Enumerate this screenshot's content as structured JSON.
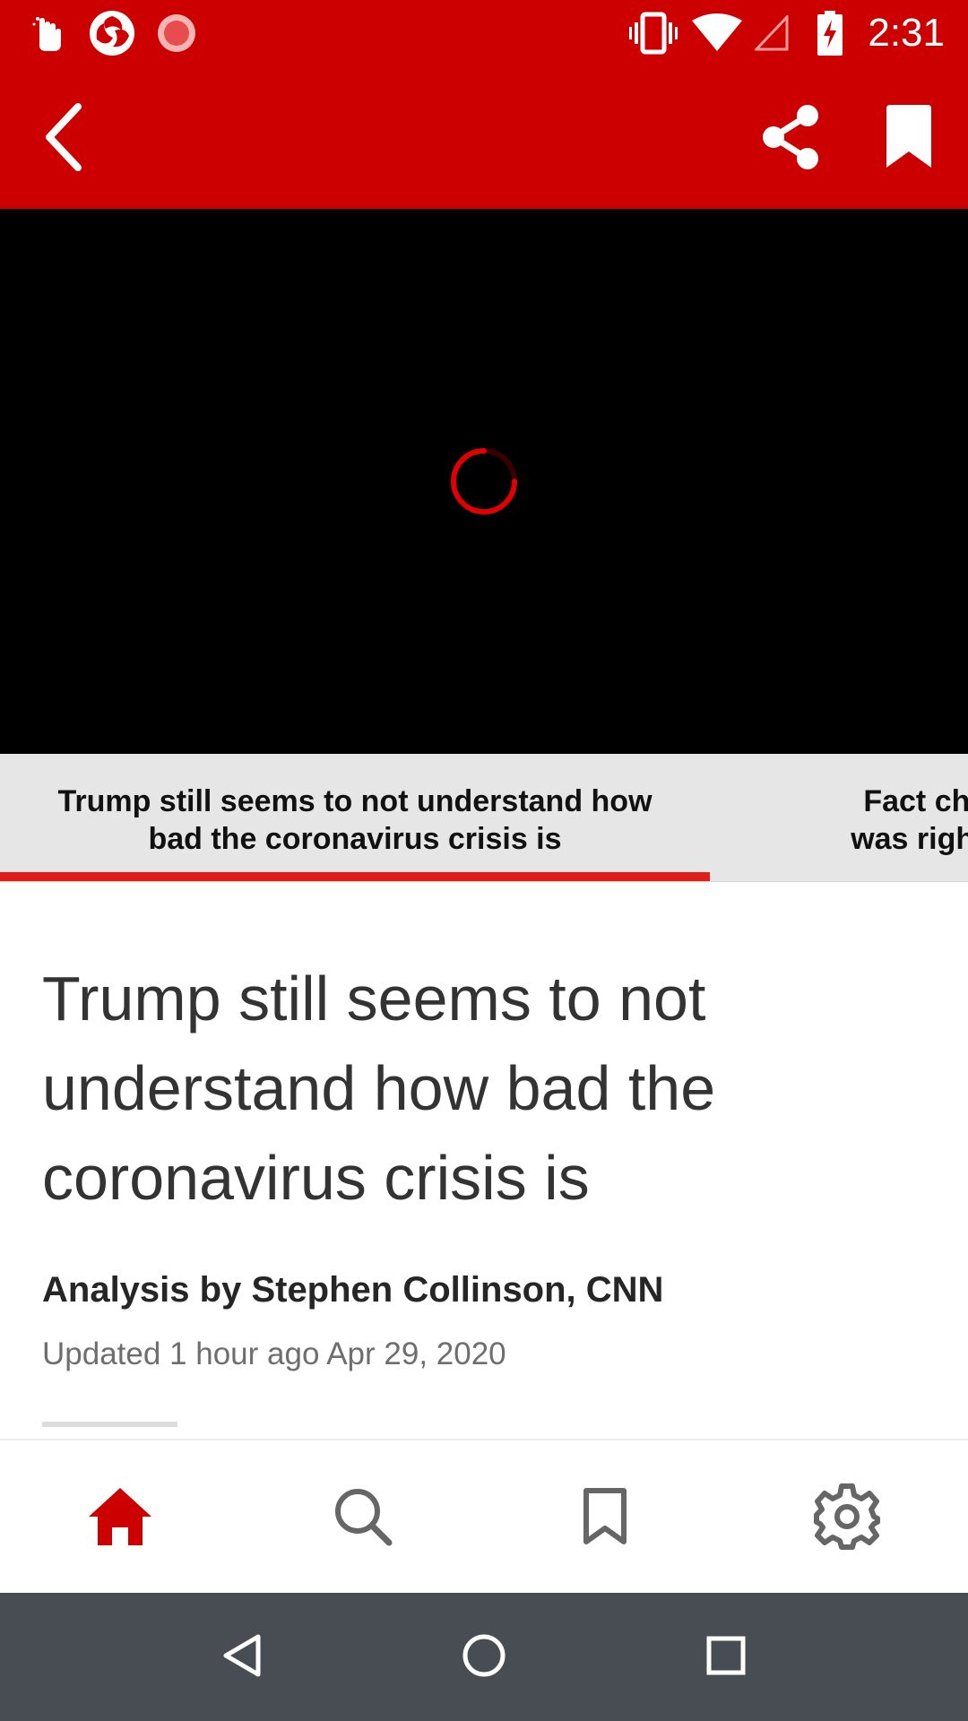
{
  "status_bar": {
    "time": "2:31",
    "left_icons": [
      "hand-icon",
      "app-swirl-icon",
      "record-icon"
    ],
    "right_icons": [
      "vibrate-icon",
      "wifi-icon",
      "cell-signal-icon",
      "battery-charging-icon"
    ]
  },
  "app_bar": {
    "back_icon": "back-arrow-icon",
    "share_icon": "share-icon",
    "bookmark_icon": "bookmark-filled-icon",
    "color": "#cc0000"
  },
  "video": {
    "state_icon": "loading-spinner-icon"
  },
  "carousel": {
    "items": [
      {
        "title": "Trump still seems to not understand how bad the coronavirus crisis is",
        "active": true
      },
      {
        "title": "Fact check: T was right when",
        "active": false
      }
    ],
    "next_line1": "Fact check: T",
    "next_line2": "was right when",
    "active_line1": "Trump still seems to not understand how",
    "active_line2": "bad the coronavirus crisis is",
    "accent": "#e21b1b"
  },
  "article": {
    "headline": "Trump still seems to not understand how bad the coronavirus crisis is",
    "byline": "Analysis by Stephen Collinson, CNN",
    "updated": "Updated 1 hour ago Apr 29, 2020"
  },
  "bottom_nav": {
    "items": [
      {
        "icon": "home-icon",
        "active": true
      },
      {
        "icon": "search-icon",
        "active": false
      },
      {
        "icon": "bookmark-outline-icon",
        "active": false
      },
      {
        "icon": "settings-gear-icon",
        "active": false
      }
    ],
    "active_color": "#cc0000",
    "inactive_color": "#666666"
  },
  "system_nav": {
    "items": [
      "back-triangle-icon",
      "home-circle-icon",
      "recents-square-icon"
    ]
  }
}
